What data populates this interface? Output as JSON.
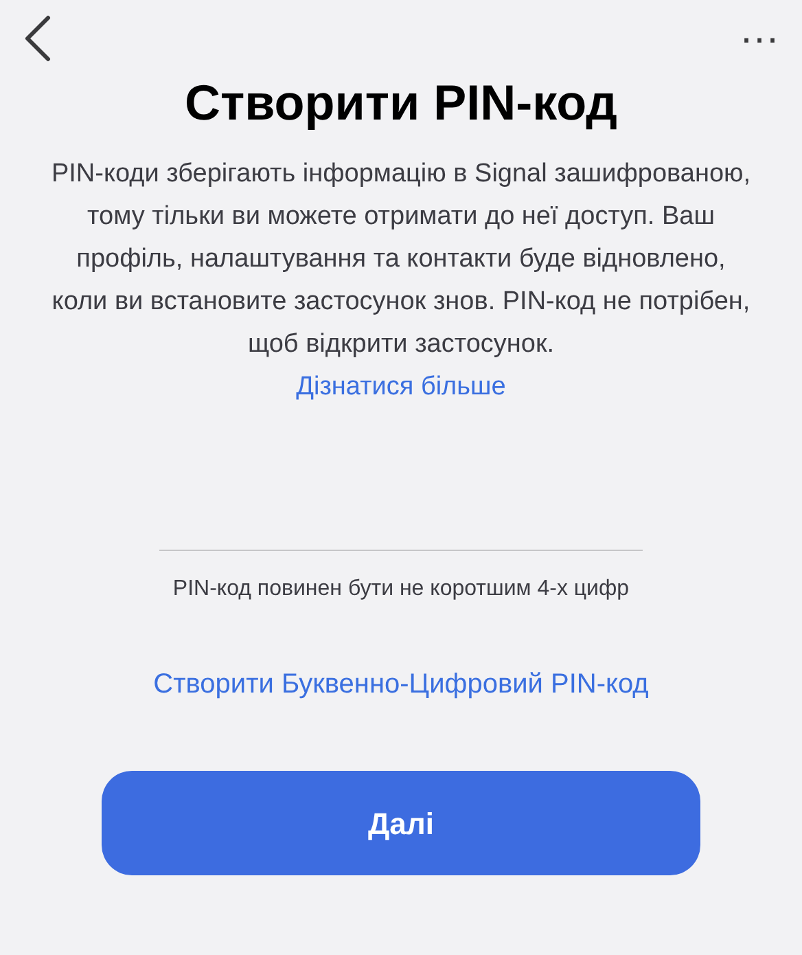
{
  "nav": {
    "more": "…"
  },
  "title": "Створити PIN-код",
  "description": "PIN-коди зберігають інформацію в Signal зашифрованою, тому тільки ви можете отримати до неї доступ. Ваш профіль, налаштування та контакти буде відновлено, коли ви встановите застосунок знов. PIN-код не потрібен, щоб відкрити застосунок.",
  "learn_more": "Дізнатися більше",
  "pin_hint": "PIN-код повинен бути не коротшим 4-х цифр",
  "alphanumeric_link": "Створити Буквенно-Цифровий PIN-код",
  "next_button": "Далі"
}
